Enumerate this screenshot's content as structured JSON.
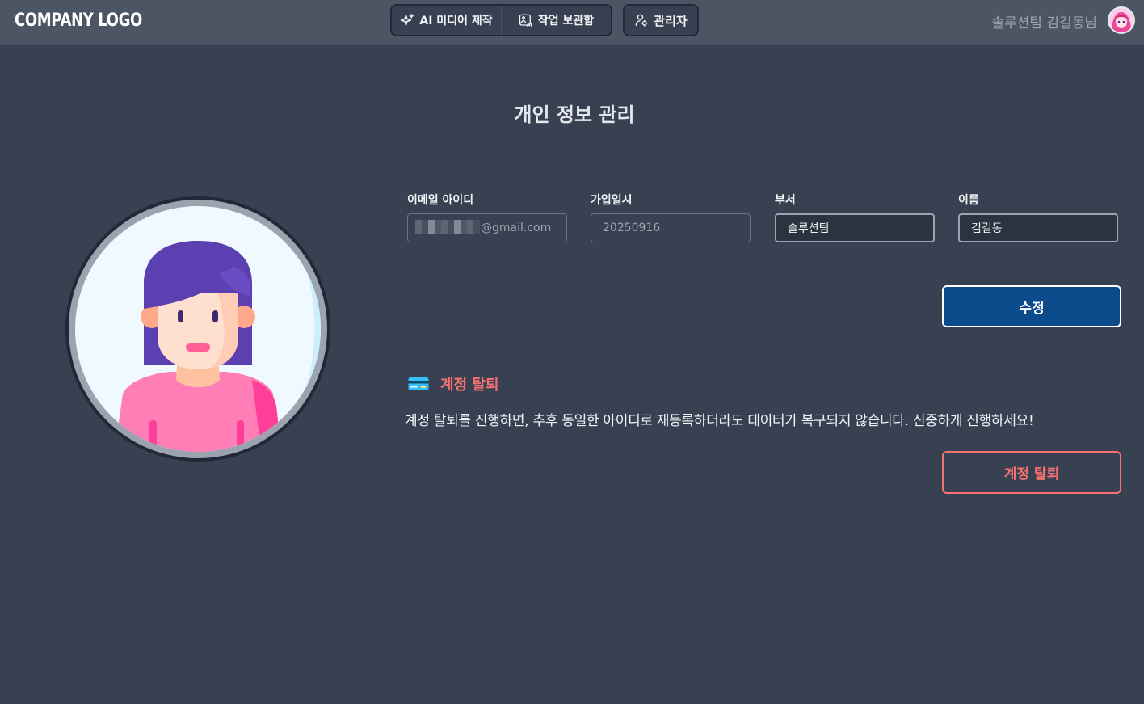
{
  "header": {
    "logo": "COMPANY LOGO",
    "nav": [
      {
        "label": "AI 미디어 제작",
        "icon": "sparkle-icon"
      },
      {
        "label": "작업 보관함",
        "icon": "ai-image-icon"
      }
    ],
    "admin_label": "관리자",
    "admin_icon": "user-settings-icon",
    "user_name": "솔루션팀 김길동님"
  },
  "page": {
    "title": "개인 정보 관리"
  },
  "form": {
    "email": {
      "label": "이메일 아이디",
      "value": "@gmail.com"
    },
    "joined": {
      "label": "가입일시",
      "value": "20250916"
    },
    "department": {
      "label": "부서",
      "value": "솔루션팀"
    },
    "name": {
      "label": "이름",
      "value": "김길동"
    },
    "edit_label": "수정"
  },
  "withdraw": {
    "title": "계정 탈퇴",
    "icon": "credit-card-icon",
    "description": "계정 탈퇴를 진행하면, 추후 동일한 아이디로 재등록하더라도 데이터가 복구되지 않습니다. 신중하게 진행하세요!",
    "button_label": "계정 탈퇴"
  },
  "colors": {
    "background": "#374151",
    "header": "#4b5563",
    "primary": "#0b4a8b",
    "danger": "#f87171"
  }
}
